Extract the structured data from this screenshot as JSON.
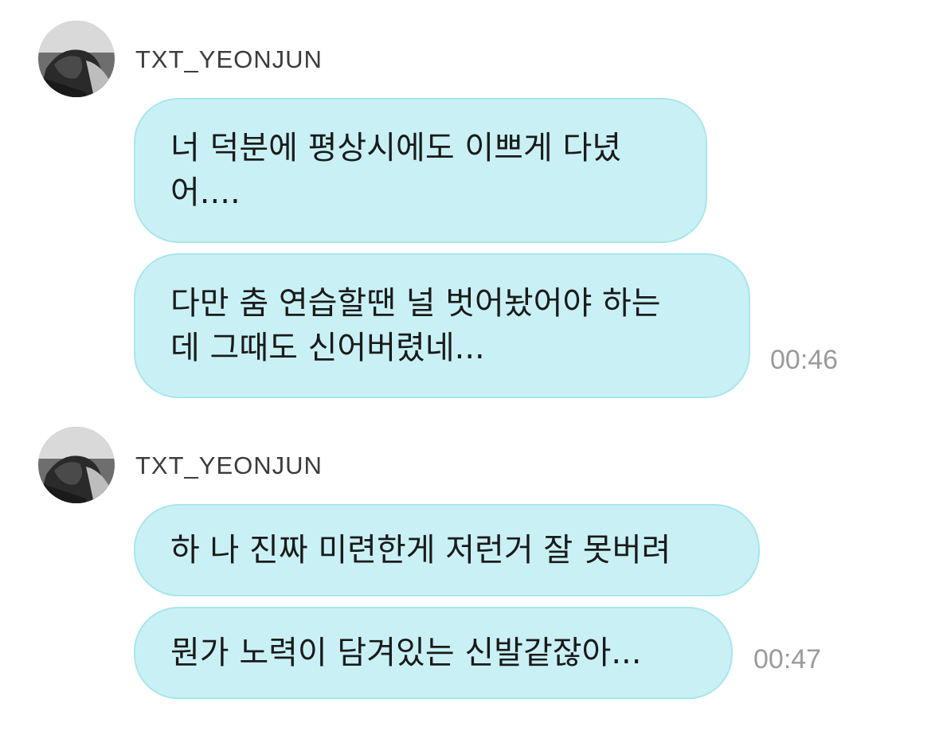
{
  "messages": [
    {
      "sender": "TXT_YEONJUN",
      "bubbles": [
        "너 덕분에 평상시에도 이쁘게 다녔\n어....",
        "다만 춤 연습할땐 널 벗어놨어야 하는\n데 그때도 신어버렸네..."
      ],
      "time": "00:46"
    },
    {
      "sender": "TXT_YEONJUN",
      "bubbles": [
        "하 나 진짜 미련한게 저런거 잘 못버려",
        "뭔가 노력이 담겨있는 신발같잖아..."
      ],
      "time": "00:47"
    }
  ],
  "colors": {
    "bubble_fill": "#c9f1f5",
    "bubble_border": "#a9e6ec",
    "timestamp": "#9b9b9b"
  }
}
